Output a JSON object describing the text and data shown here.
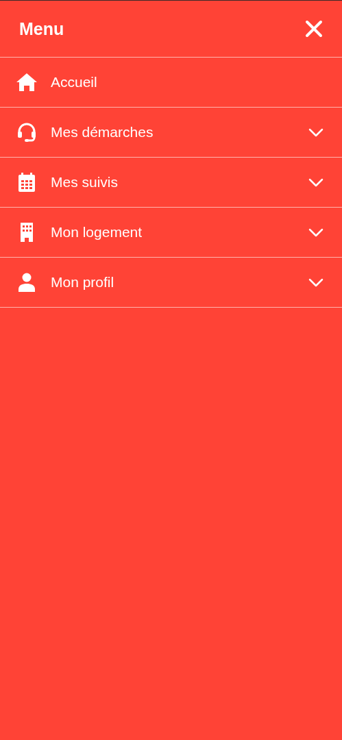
{
  "header": {
    "title": "Menu"
  },
  "items": [
    {
      "label": "Accueil",
      "kind": "link"
    },
    {
      "label": "Mes démarches",
      "kind": "group",
      "expanded": false
    },
    {
      "label": "Mes suivis",
      "kind": "group",
      "expanded": false
    },
    {
      "label": "Mon logement",
      "kind": "group",
      "expanded": false
    },
    {
      "label": "Mon profil",
      "kind": "group",
      "expanded": false
    }
  ]
}
